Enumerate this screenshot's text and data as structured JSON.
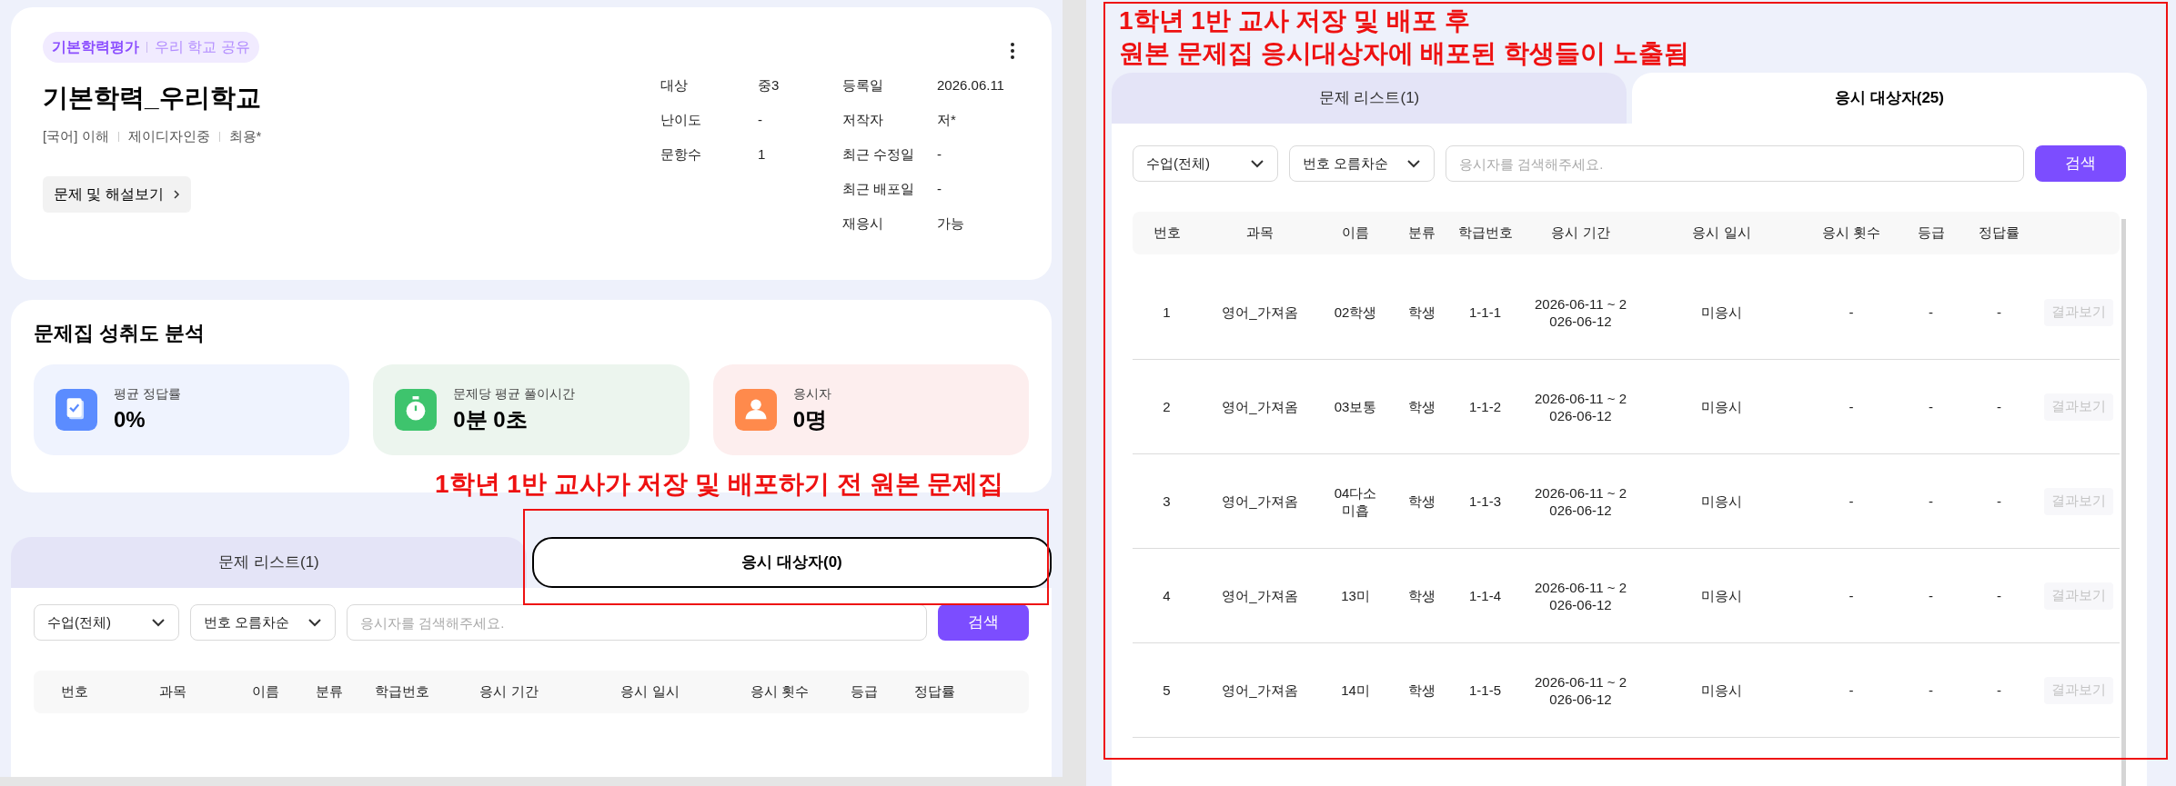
{
  "left": {
    "card": {
      "chips": [
        "기본학력평가",
        "우리 학교 공유"
      ],
      "title": "기본학력_우리학교",
      "meta": [
        "[국어] 이해",
        "제이디자인중",
        "최용*"
      ],
      "view_button": "문제 및 해설보기",
      "info_left": [
        {
          "label": "대상",
          "value": "중3"
        },
        {
          "label": "난이도",
          "value": "-"
        },
        {
          "label": "문항수",
          "value": "1"
        }
      ],
      "info_right": [
        {
          "label": "등록일",
          "value": "2026.06.11"
        },
        {
          "label": "저작자",
          "value": "저*"
        },
        {
          "label": "최근 수정일",
          "value": "-"
        },
        {
          "label": "최근 배포일",
          "value": "-"
        },
        {
          "label": "재응시",
          "value": "가능"
        }
      ]
    },
    "analysis": {
      "title": "문제집 성취도 분석",
      "stats": [
        {
          "kind": "rate",
          "label": "평균 정답률",
          "value": "0%",
          "color": "#5b8cff"
        },
        {
          "kind": "time",
          "label": "문제당 평균 풀이시간",
          "value": "0분 0초",
          "color": "#3ec46d"
        },
        {
          "kind": "person",
          "label": "응시자",
          "value": "0명",
          "color": "#ff8a4c"
        }
      ]
    },
    "tabs": [
      {
        "label": "문제 리스트(1)",
        "selected": false
      },
      {
        "label": "응시 대상자(0)",
        "selected": true
      }
    ],
    "filters": {
      "class_select": "수업(전체)",
      "sort_select": "번호 오름차순",
      "search": {
        "placeholder": "응시자를 검색해주세요."
      },
      "search_button": "검색"
    },
    "columns": [
      "번호",
      "과목",
      "이름",
      "분류",
      "학급번호",
      "응시 기간",
      "응시 일시",
      "응시 횟수",
      "등급",
      "정답률"
    ]
  },
  "right": {
    "tabs": [
      {
        "label": "문제 리스트(1)",
        "selected": false
      },
      {
        "label": "응시 대상자(25)",
        "selected": true
      }
    ],
    "filters": {
      "class_select": "수업(전체)",
      "sort_select": "번호 오름차순",
      "search": {
        "placeholder": "응시자를 검색해주세요."
      },
      "search_button": "검색"
    },
    "columns": [
      "번호",
      "과목",
      "이름",
      "분류",
      "학급번호",
      "응시 기간",
      "응시 일시",
      "응시 횟수",
      "등급",
      "정답률"
    ],
    "rows": [
      {
        "cells": [
          "1",
          "영어_가져옴",
          "02학생",
          "학생",
          "1-1-1",
          "2026-06-11 ~ 2\n026-06-12",
          "미응시",
          "-",
          "-",
          "-"
        ],
        "action": {
          "label": "결과보기",
          "disabled": true
        }
      },
      {
        "cells": [
          "2",
          "영어_가져옴",
          "03보통",
          "학생",
          "1-1-2",
          "2026-06-11 ~ 2\n026-06-12",
          "미응시",
          "-",
          "-",
          "-"
        ],
        "action": {
          "label": "결과보기",
          "disabled": true
        }
      },
      {
        "cells": [
          "3",
          "영어_가져옴",
          "04다소\n미흡",
          "학생",
          "1-1-3",
          "2026-06-11 ~ 2\n026-06-12",
          "미응시",
          "-",
          "-",
          "-"
        ],
        "action": {
          "label": "결과보기",
          "disabled": true
        }
      },
      {
        "cells": [
          "4",
          "영어_가져옴",
          "13미",
          "학생",
          "1-1-4",
          "2026-06-11 ~ 2\n026-06-12",
          "미응시",
          "-",
          "-",
          "-"
        ],
        "action": {
          "label": "결과보기",
          "disabled": true
        }
      },
      {
        "cells": [
          "5",
          "영어_가져옴",
          "14미",
          "학생",
          "1-1-5",
          "2026-06-11 ~ 2\n026-06-12",
          "미응시",
          "-",
          "-",
          "-"
        ],
        "action": {
          "label": "결과보기",
          "disabled": true
        }
      }
    ]
  },
  "annotations": [
    {
      "lines": [
        "1학년 1반 교사가 저장 및 배포하기 전 원본 문제집"
      ]
    },
    {
      "lines": [
        "1학년 1반 교사 저장 및 배포 후",
        "원본 문제집 응시대상자에 배포된 학생들이 노출됨"
      ]
    }
  ]
}
